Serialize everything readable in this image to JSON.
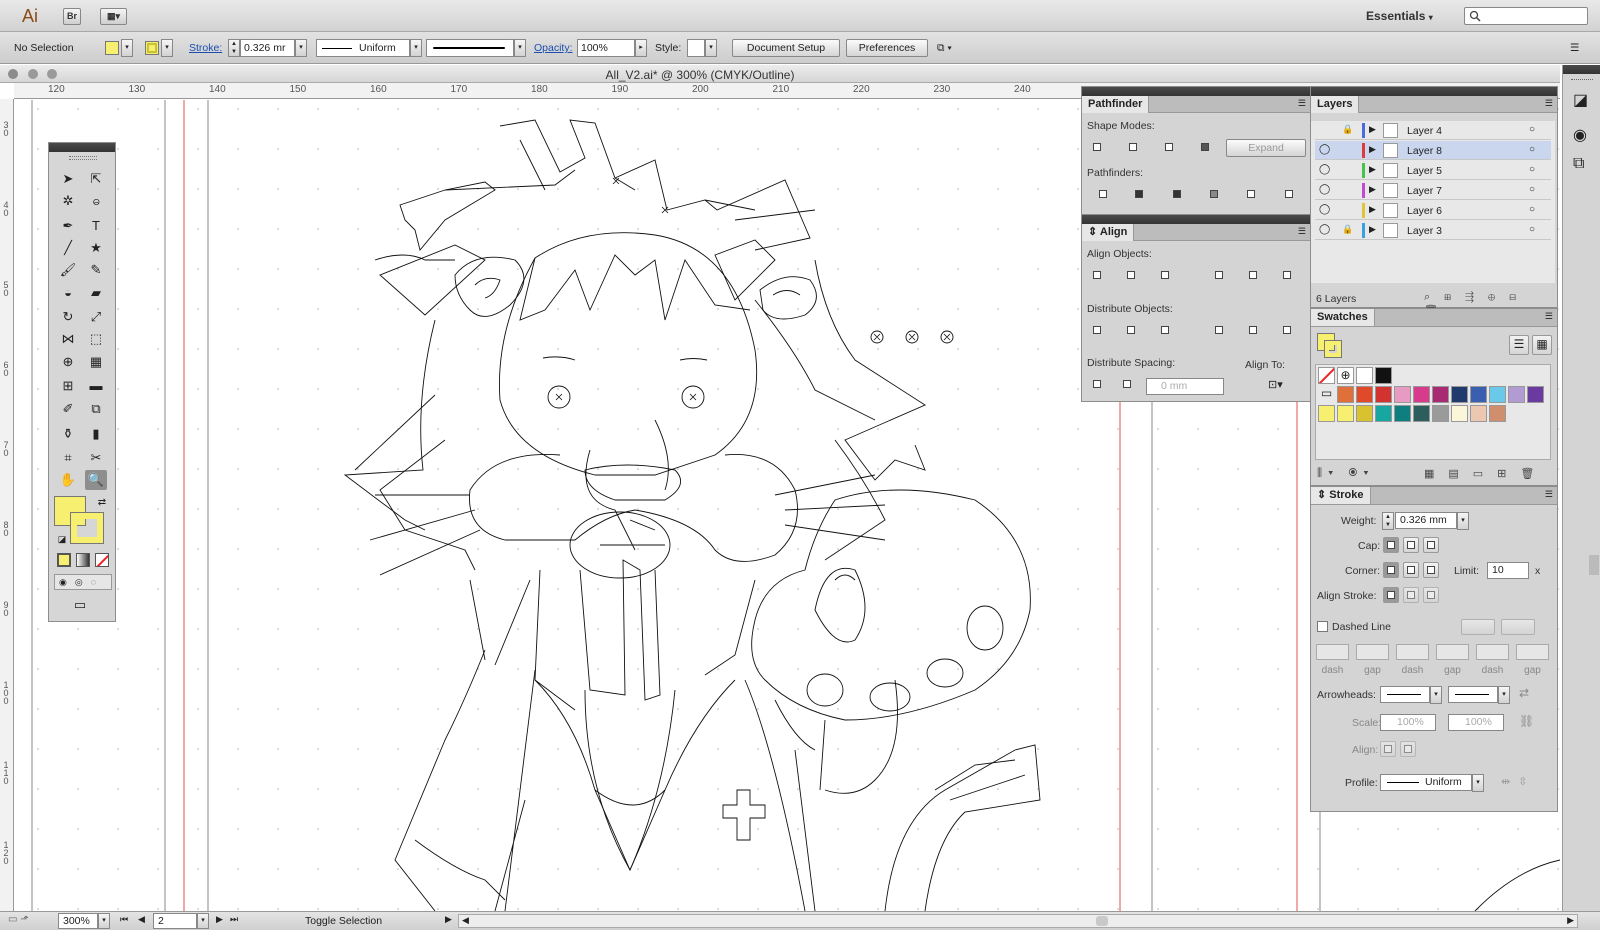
{
  "app": {
    "logo": "Ai",
    "bridge": "Br",
    "workspace": "Essentials"
  },
  "control": {
    "selection": "No Selection",
    "stroke_label": "Stroke:",
    "stroke_value": "0.326 mr",
    "profile_label": "Uniform",
    "opacity_label": "Opacity:",
    "opacity_value": "100%",
    "style_label": "Style:",
    "document_setup": "Document Setup",
    "preferences": "Preferences"
  },
  "document": {
    "title": "All_V2.ai* @ 300% (CMYK/Outline)"
  },
  "ruler": {
    "h_ticks": [
      "120",
      "130",
      "140",
      "150",
      "160",
      "170",
      "180",
      "190",
      "200",
      "210",
      "220",
      "230",
      "240"
    ]
  },
  "pathfinder": {
    "tab": "Pathfinder",
    "shape_modes": "Shape Modes:",
    "expand": "Expand",
    "pathfinders": "Pathfinders:"
  },
  "align": {
    "tab": "Align",
    "align_objects": "Align Objects:",
    "distribute_objects": "Distribute Objects:",
    "distribute_spacing": "Distribute Spacing:",
    "align_to": "Align To:",
    "spacing_value": "0 mm"
  },
  "layers": {
    "tab": "Layers",
    "items": [
      {
        "name": "Layer 4",
        "color": "#4a6ae0"
      },
      {
        "name": "Layer 8",
        "color": "#e03a3a"
      },
      {
        "name": "Layer 5",
        "color": "#47c24a"
      },
      {
        "name": "Layer 7",
        "color": "#c24ad0"
      },
      {
        "name": "Layer 6",
        "color": "#e0c43a"
      },
      {
        "name": "Layer 3",
        "color": "#3aa0e0"
      }
    ],
    "count": "6 Layers"
  },
  "swatches": {
    "tab": "Swatches",
    "colors_row1": [
      "#e0703a",
      "#e04a2a",
      "#d2332e",
      "#e79ac2",
      "#d83b8c",
      "#a82a72",
      "#203a6e",
      "#3b5fb0",
      "#6ac8e8",
      "#b29ad2",
      "#6a3aa0"
    ],
    "colors_row2": [
      "#f6ef6f",
      "#d8c230",
      "#17a6a0",
      "#0f7e7e",
      "#2d5e5e",
      "#9a9a9a",
      "#fbf5da",
      "#ecc8b0",
      "#cf8e6e"
    ]
  },
  "stroke": {
    "tab": "Stroke",
    "weight_label": "Weight:",
    "weight_value": "0.326 mm",
    "cap_label": "Cap:",
    "corner_label": "Corner:",
    "limit_label": "Limit:",
    "limit_value": "10",
    "limit_x": "x",
    "align_stroke_label": "Align Stroke:",
    "dashed_line": "Dashed Line",
    "dash": "dash",
    "gap": "gap",
    "arrowheads_label": "Arrowheads:",
    "scale_label": "Scale:",
    "scale_value": "100%",
    "align_label": "Align:",
    "profile_label": "Profile:",
    "profile_value": "Uniform"
  },
  "status": {
    "zoom": "300%",
    "page": "2",
    "info": "Toggle Selection"
  }
}
